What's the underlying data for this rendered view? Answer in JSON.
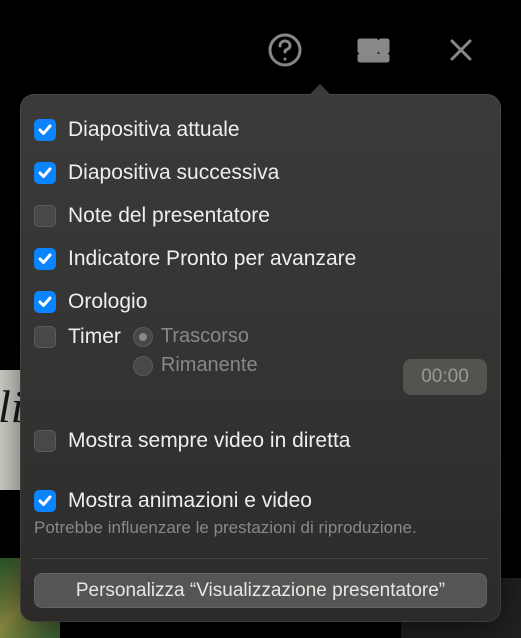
{
  "toolbar": {
    "help": "help",
    "layout": "layout-options",
    "close": "close"
  },
  "options": {
    "current_slide": {
      "label": "Diapositiva attuale",
      "checked": true
    },
    "next_slide": {
      "label": "Diapositiva successiva",
      "checked": true
    },
    "presenter_notes": {
      "label": "Note del presentatore",
      "checked": false
    },
    "ready_indicator": {
      "label": "Indicatore Pronto per avanzare",
      "checked": true
    },
    "clock": {
      "label": "Orologio",
      "checked": true
    },
    "timer": {
      "label": "Timer",
      "checked": false
    },
    "timer_modes": {
      "elapsed": {
        "label": "Trascorso",
        "selected": true
      },
      "remaining": {
        "label": "Rimanente",
        "selected": false
      }
    },
    "timer_value": "00:00",
    "always_live_video": {
      "label": "Mostra sempre video in diretta",
      "checked": false
    },
    "show_animations": {
      "label": "Mostra animazioni e video",
      "checked": true
    },
    "show_animations_hint": "Potrebbe influenzare le prestazioni di riproduzione."
  },
  "footer": {
    "customize_button": "Personalizza “Visualizzazione presentatore”"
  },
  "bg_letter": "li"
}
